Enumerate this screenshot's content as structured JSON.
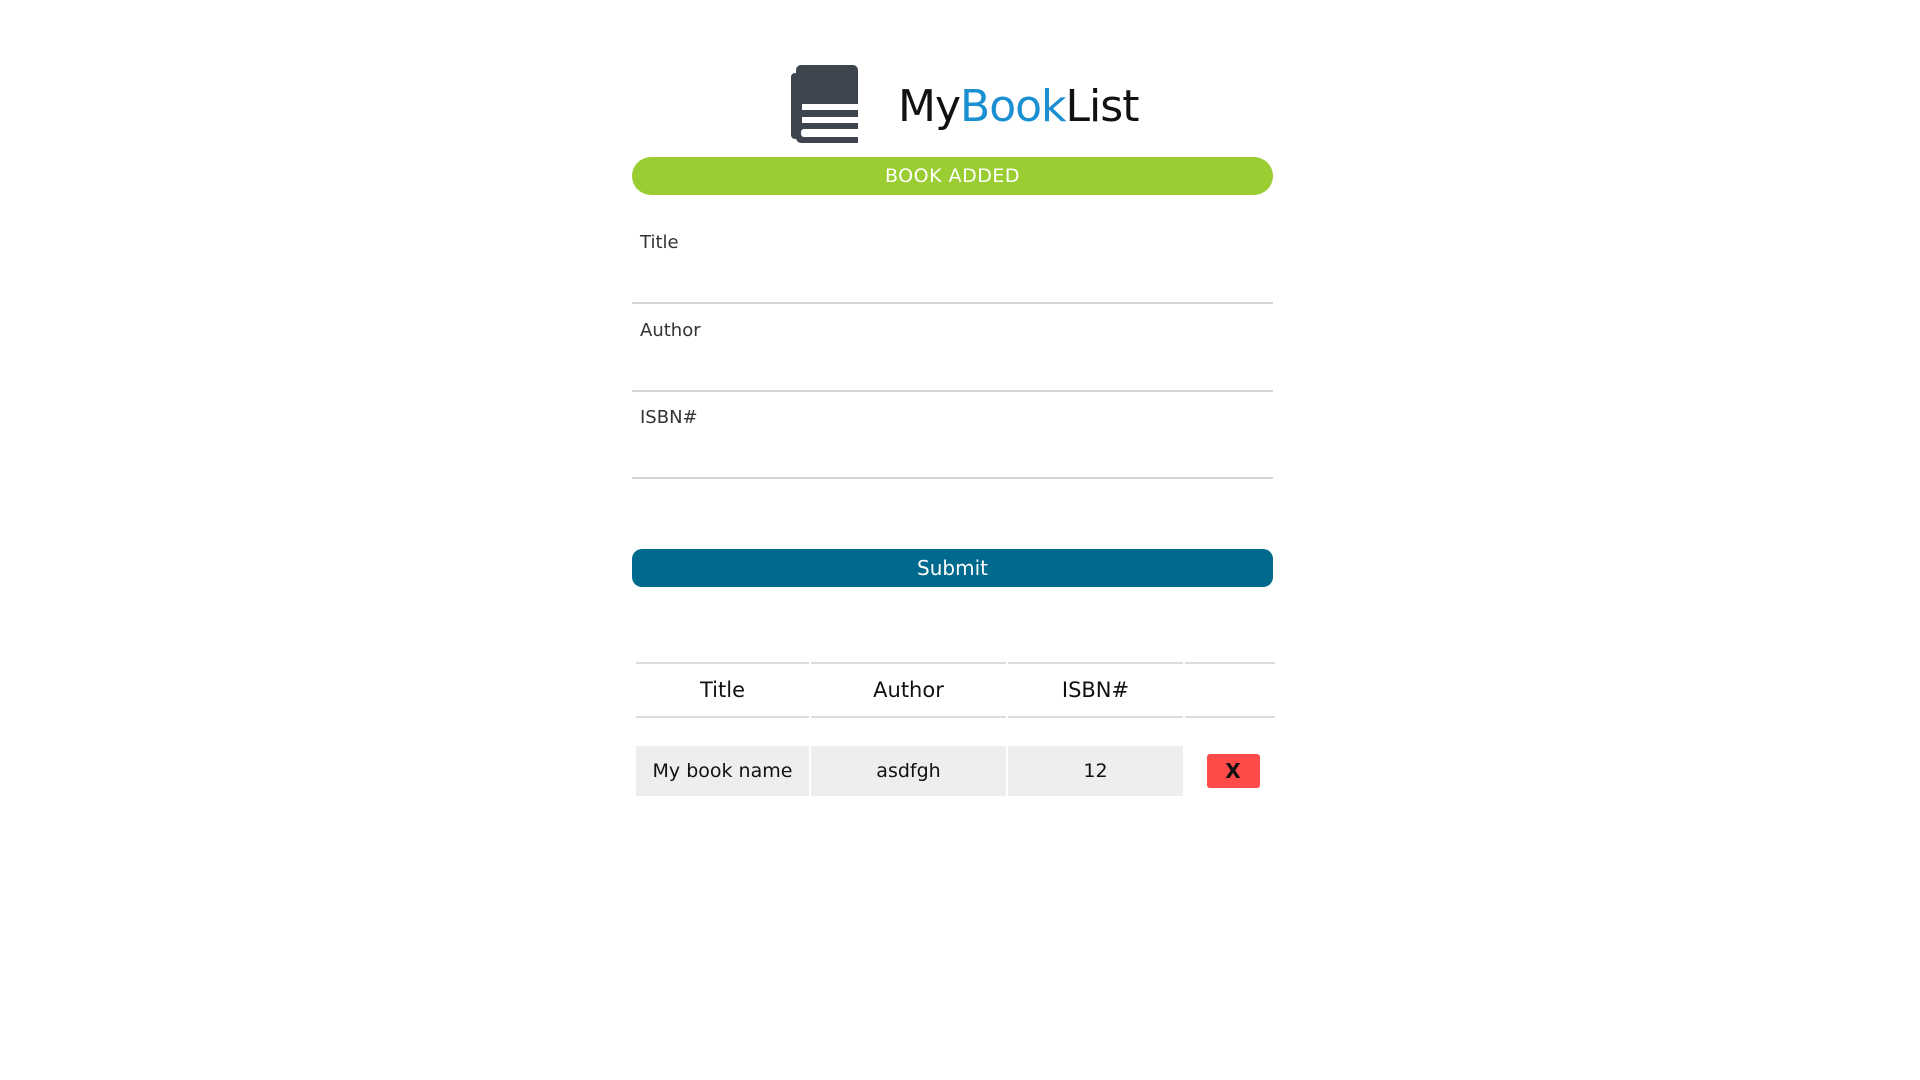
{
  "header": {
    "icon": "book-icon",
    "brand_part1": "My",
    "brand_part2": "Book",
    "brand_part3": "List"
  },
  "banner": {
    "text": "BOOK ADDED",
    "color": "#9acd32"
  },
  "form": {
    "title_label": "Title",
    "title_value": "",
    "author_label": "Author",
    "author_value": "",
    "isbn_label": "ISBN#",
    "isbn_value": "",
    "submit_label": "Submit",
    "submit_color": "#006a8e"
  },
  "table": {
    "columns": [
      "Title",
      "Author",
      "ISBN#",
      ""
    ],
    "rows": [
      {
        "title": "My book name",
        "author": "asdfgh",
        "isbn": "12",
        "delete_label": "X"
      }
    ],
    "delete_color": "#ff4a4a"
  },
  "colors": {
    "brand_accent": "#1a8fd1",
    "icon": "#3f454e"
  }
}
